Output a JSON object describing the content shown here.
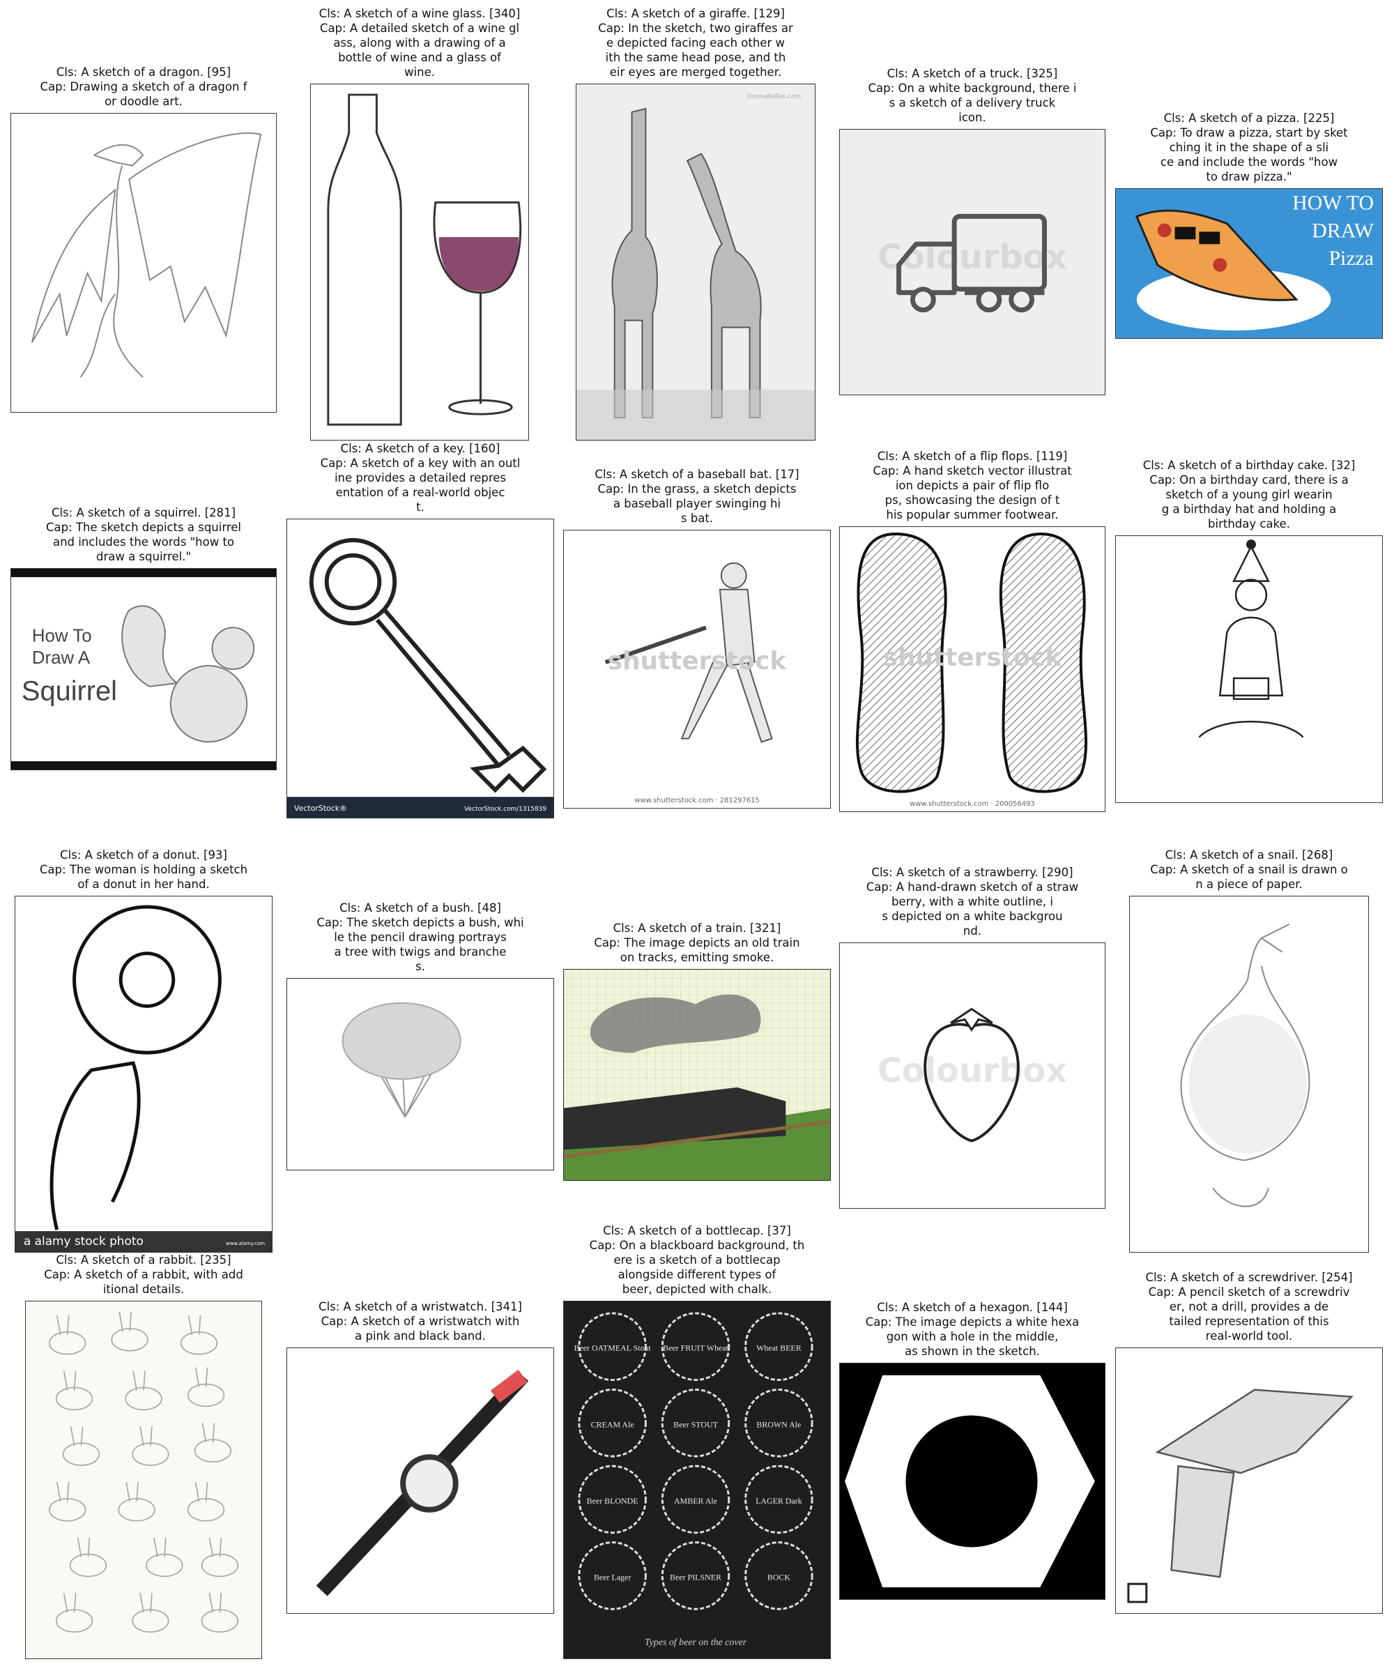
{
  "panels": [
    {
      "cls": "Cls: A sketch of a dragon. [95]",
      "cap": [
        "Cap: Drawing a sketch of a dragon f",
        "or doodle art."
      ]
    },
    {
      "cls": "Cls: A sketch of a wine glass. [340]",
      "cap": [
        "Cap: A detailed sketch of a wine gl",
        "ass, along with a drawing of a",
        "bottle of wine and a glass of",
        "wine."
      ]
    },
    {
      "cls": "Cls: A sketch of a giraffe. [129]",
      "cap": [
        "Cap: In the sketch, two giraffes ar",
        "e depicted facing each other w",
        "ith the same head pose, and th",
        "eir eyes are merged together."
      ],
      "image_text": "DonnaBellas.com"
    },
    {
      "cls": "Cls: A sketch of a truck. [325]",
      "cap": [
        "Cap: On a white background, there i",
        "s a sketch of a delivery truck",
        "icon."
      ],
      "image_text": "Colourbox"
    },
    {
      "cls": "Cls: A sketch of a pizza. [225]",
      "cap": [
        "Cap: To draw a pizza, start by sket",
        "ching it in the shape of a sli",
        "ce and include the words \"how",
        "to draw pizza.\""
      ],
      "image_text": [
        "HOW TO",
        "DRAW",
        "Pizza"
      ]
    },
    {
      "cls": "Cls: A sketch of a squirrel. [281]",
      "cap": [
        "Cap: The sketch depicts a squirrel",
        "and includes the words \"how to",
        "draw a squirrel.\""
      ],
      "image_text": [
        "How To",
        "Draw A",
        "Squirrel"
      ]
    },
    {
      "cls": "Cls: A sketch of a key. [160]",
      "cap": [
        "Cap: A sketch of a key with an outl",
        "ine provides a detailed repres",
        "entation of a real-world objec",
        "t."
      ],
      "image_text": [
        "VectorStock®",
        "VectorStock.com/1315839"
      ]
    },
    {
      "cls": "Cls: A sketch of a baseball bat. [17]",
      "cap": [
        "Cap: In the grass, a sketch depicts",
        "a baseball player swinging hi",
        "s bat."
      ],
      "image_text": [
        "shutterstock",
        "www.shutterstock.com · 281297615"
      ]
    },
    {
      "cls": "Cls: A sketch of a flip flops. [119]",
      "cap": [
        "Cap: A hand sketch vector illustrat",
        "ion depicts a pair of flip flo",
        "ps, showcasing the design of t",
        "his popular summer footwear."
      ],
      "image_text": [
        "shutterstock",
        "www.shutterstock.com · 200056493"
      ]
    },
    {
      "cls": "Cls: A sketch of a birthday cake. [32]",
      "cap": [
        "Cap: On a birthday card, there is a",
        "sketch of a young girl wearin",
        "g a birthday hat and holding a",
        "birthday cake."
      ]
    },
    {
      "cls": "Cls: A sketch of a donut. [93]",
      "cap": [
        "Cap: The woman is holding a sketch",
        "of a donut in her hand."
      ],
      "image_text": [
        "a alamy stock photo",
        "www.alamy.com"
      ]
    },
    {
      "cls": "Cls: A sketch of a bush. [48]",
      "cap": [
        "Cap: The sketch depicts a bush, whi",
        "le the pencil drawing portrays",
        "a tree with twigs and branche",
        "s."
      ]
    },
    {
      "cls": "Cls: A sketch of a train. [321]",
      "cap": [
        "Cap: The image depicts an old train",
        "on tracks, emitting smoke."
      ]
    },
    {
      "cls": "Cls: A sketch of a strawberry. [290]",
      "cap": [
        "Cap: A hand-drawn sketch of a straw",
        "berry, with a white outline, i",
        "s depicted on a white backgrou",
        "nd."
      ],
      "image_text": "Colourbox"
    },
    {
      "cls": "Cls: A sketch of a snail. [268]",
      "cap": [
        "Cap: A sketch of a snail is drawn o",
        "n a piece of paper."
      ]
    },
    {
      "cls": "Cls: A sketch of a rabbit. [235]",
      "cap": [
        "Cap: A sketch of a rabbit, with add",
        "itional details."
      ]
    },
    {
      "cls": "Cls: A sketch of a wristwatch. [341]",
      "cap": [
        "Cap: A sketch of a wristwatch with",
        "a pink and black band."
      ]
    },
    {
      "cls": "Cls: A sketch of a bottlecap. [37]",
      "cap": [
        "Cap: On a blackboard background, th",
        "ere is a sketch of a bottlecap",
        "alongside different types of",
        "beer, depicted with chalk."
      ],
      "image_text": [
        "Beer OATMEAL Stout",
        "Beer FRUIT Wheat",
        "Wheat BEER",
        "CREAM Ale",
        "Beer STOUT",
        "BROWN Ale",
        "Beer BLONDE",
        "AMBER Ale",
        "LAGER Dark",
        "Beer Lager",
        "Beer PILSNER",
        "BOCK",
        "Types of beer on the cover"
      ]
    },
    {
      "cls": "Cls: A sketch of a hexagon. [144]",
      "cap": [
        "Cap: The image depicts a white hexa",
        "gon with a hole in the middle,",
        "as shown in the sketch."
      ]
    },
    {
      "cls": "Cls: A sketch of a screwdriver. [254]",
      "cap": [
        "Cap: A pencil sketch of a screwdriv",
        "er, not a drill, provides a de",
        "tailed representation of this",
        "real-world tool."
      ]
    }
  ]
}
